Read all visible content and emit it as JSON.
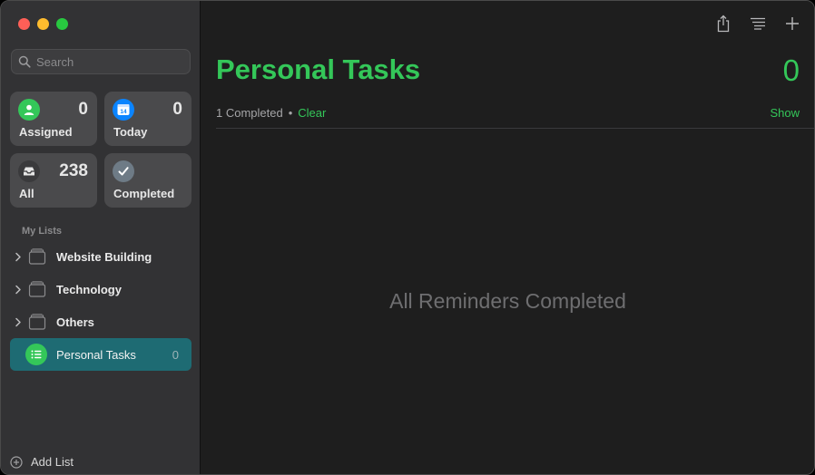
{
  "sidebar": {
    "search_placeholder": "Search",
    "smart_lists": [
      {
        "label": "Assigned",
        "count": "0",
        "icon": "person-icon",
        "color": "#34c759"
      },
      {
        "label": "Today",
        "count": "0",
        "icon": "calendar-icon",
        "color": "#0a84ff",
        "calendar_day": "14"
      },
      {
        "label": "All",
        "count": "238",
        "icon": "tray-icon",
        "color": "#3a3a3c"
      },
      {
        "label": "Completed",
        "count": "",
        "icon": "checkmark-icon",
        "color": "#6e7b86"
      }
    ],
    "my_lists_heading": "My Lists",
    "lists": [
      {
        "name": "Website Building",
        "type": "group"
      },
      {
        "name": "Technology",
        "type": "group"
      },
      {
        "name": "Others",
        "type": "group"
      },
      {
        "name": "Personal Tasks",
        "count": "0",
        "selected": true,
        "color": "#34c759"
      }
    ],
    "add_list_label": "Add List"
  },
  "main": {
    "title": "Personal Tasks",
    "count": "0",
    "completed_text": "1 Completed",
    "separator": "•",
    "clear_label": "Clear",
    "show_label": "Show",
    "empty_message": "All Reminders Completed",
    "accent_color": "#34c759"
  },
  "toolbar": {
    "icons": [
      "share-icon",
      "list-style-icon",
      "plus-icon"
    ]
  }
}
